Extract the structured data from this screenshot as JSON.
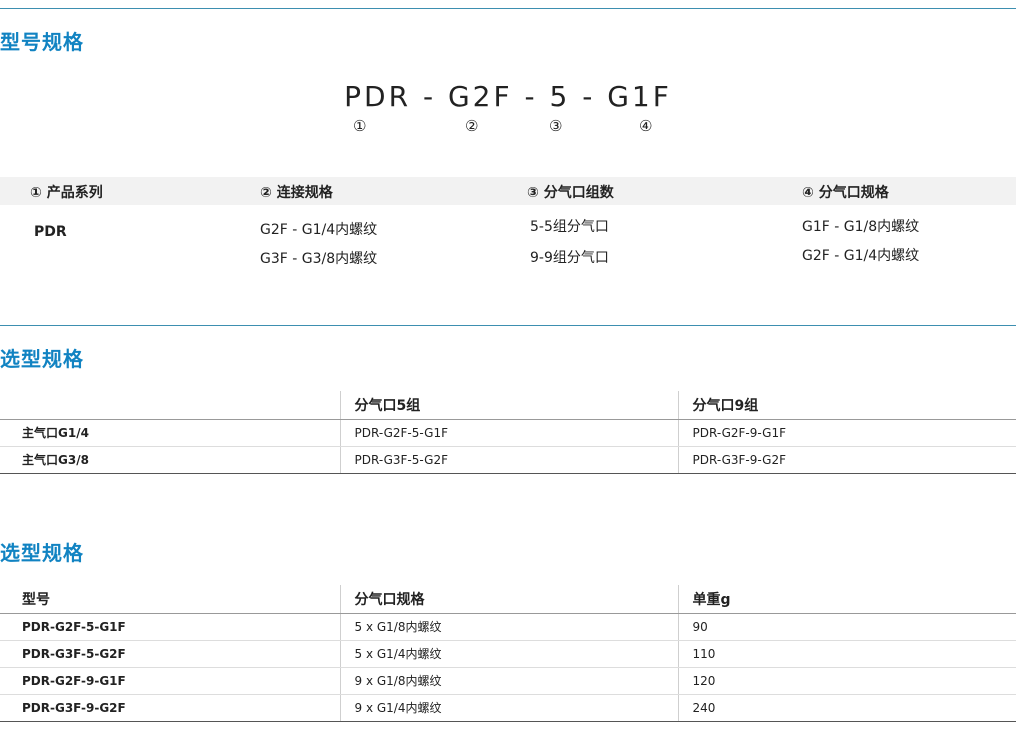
{
  "section1": {
    "title": "型号规格",
    "model_parts": [
      "PDR",
      "G2F",
      "5",
      "G1F"
    ],
    "model_code": "PDR - G2F - 5 - G1F",
    "markers": [
      "①",
      "②",
      "③",
      "④"
    ],
    "columns": [
      {
        "header": "① 产品系列",
        "items": [
          "PDR"
        ]
      },
      {
        "header": "② 连接规格",
        "items": [
          "G2F - G1/4内螺纹",
          "G3F - G3/8内螺纹"
        ]
      },
      {
        "header": "③ 分气口组数",
        "items": [
          "5-5组分气口",
          "9-9组分气口"
        ]
      },
      {
        "header": "④ 分气口规格",
        "items": [
          "G1F - G1/8内螺纹",
          "G2F - G1/4内螺纹"
        ]
      }
    ]
  },
  "section2": {
    "title": "选型规格",
    "headers": [
      "",
      "分气口5组",
      "分气口9组"
    ],
    "rows": [
      [
        "主气口G1/4",
        "PDR-G2F-5-G1F",
        "PDR-G2F-9-G1F"
      ],
      [
        "主气口G3/8",
        "PDR-G3F-5-G2F",
        "PDR-G3F-9-G2F"
      ]
    ]
  },
  "section3": {
    "title": "选型规格",
    "headers": [
      "型号",
      "分气口规格",
      "单重g"
    ],
    "rows": [
      [
        "PDR-G2F-5-G1F",
        "5 x G1/8内螺纹",
        "90"
      ],
      [
        "PDR-G3F-5-G2F",
        "5 x G1/4内螺纹",
        "110"
      ],
      [
        "PDR-G2F-9-G1F",
        "9 x G1/8内螺纹",
        "120"
      ],
      [
        "PDR-G3F-9-G2F",
        "9 x G1/4内螺纹",
        "240"
      ]
    ]
  },
  "colors": {
    "accent": "#1183c2",
    "rule": "#3d8fb0",
    "header_bg": "#f2f2f2"
  }
}
